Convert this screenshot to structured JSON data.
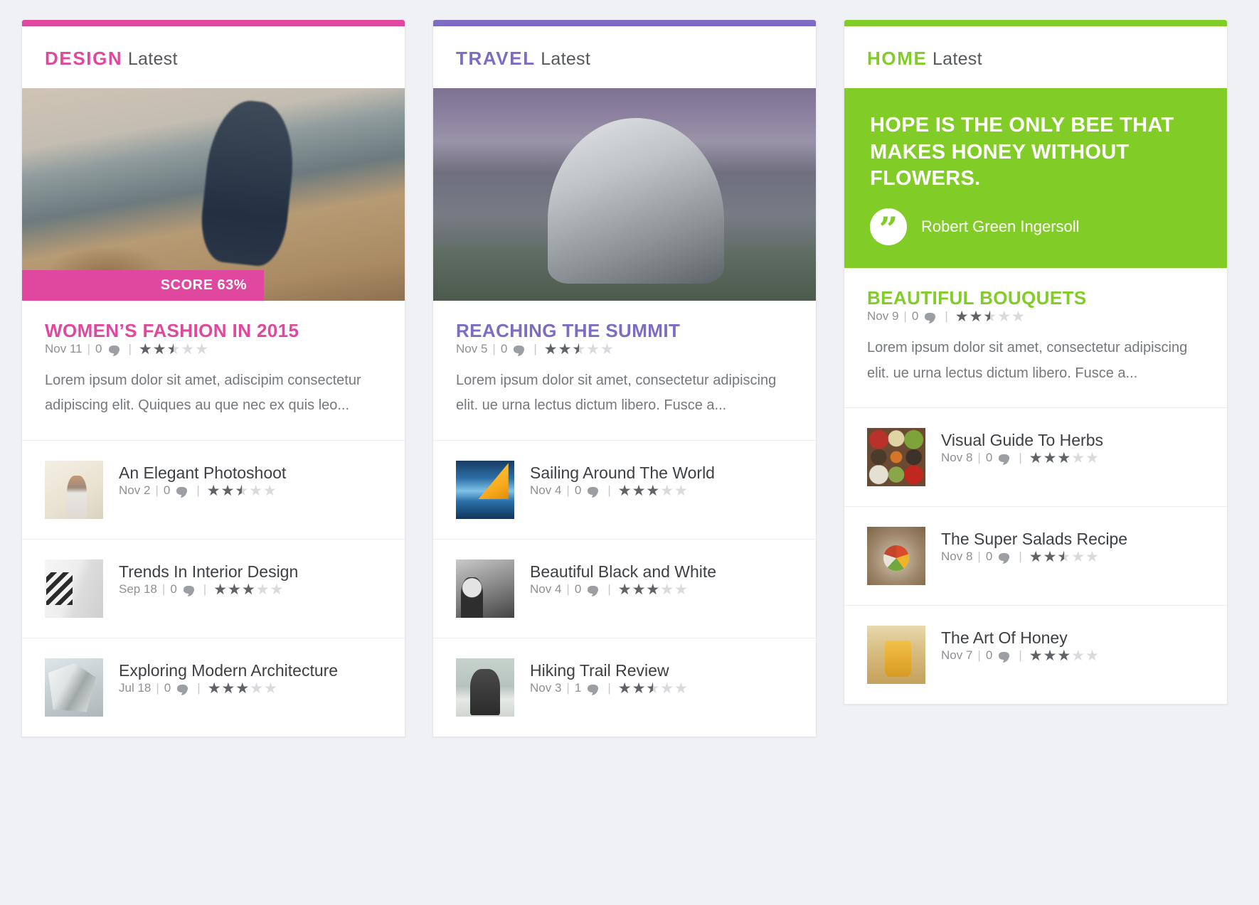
{
  "page": {
    "background": "#eff1f4"
  },
  "columns": [
    {
      "id": "design",
      "accent": "#e0479e",
      "header": {
        "category": "DESIGN",
        "subtitle": "Latest"
      },
      "hero": {
        "image_name": "woman-on-dock-photo",
        "badge": {
          "label": "SCORE 63%",
          "value": 63
        }
      },
      "featured": {
        "title": "WOMEN’S FASHION IN 2015",
        "date": "Nov 11",
        "comments": "0",
        "rating": 2.5,
        "excerpt": "Lorem ipsum dolor sit amet, adiscipim consectetur adipiscing elit. Quiques au que nec ex quis leo..."
      },
      "items": [
        {
          "title": "An Elegant Photoshoot",
          "date": "Nov 2",
          "comments": "0",
          "rating": 2.5,
          "image_name": "elegant-photoshoot-thumb"
        },
        {
          "title": "Trends In Interior Design",
          "date": "Sep 18",
          "comments": "0",
          "rating": 3,
          "image_name": "interior-design-thumb"
        },
        {
          "title": "Exploring Modern Architecture",
          "date": "Jul 18",
          "comments": "0",
          "rating": 3,
          "image_name": "modern-architecture-thumb"
        }
      ]
    },
    {
      "id": "travel",
      "accent": "#7d6bc4",
      "header": {
        "category": "TRAVEL",
        "subtitle": "Latest"
      },
      "hero": {
        "image_name": "half-dome-mountain-photo"
      },
      "featured": {
        "title": "REACHING THE SUMMIT",
        "date": "Nov 5",
        "comments": "0",
        "rating": 2.5,
        "excerpt": "Lorem ipsum dolor sit amet, consectetur adipiscing elit. ue urna lectus dictum libero. Fusce a..."
      },
      "items": [
        {
          "title": "Sailing Around The World",
          "date": "Nov 4",
          "comments": "0",
          "rating": 3,
          "image_name": "sailboat-thumb"
        },
        {
          "title": "Beautiful Black and White",
          "date": "Nov 4",
          "comments": "0",
          "rating": 3,
          "image_name": "black-and-white-portrait-thumb"
        },
        {
          "title": "Hiking Trail Review",
          "date": "Nov 3",
          "comments": "1",
          "rating": 2.5,
          "image_name": "hikers-thumb"
        }
      ]
    },
    {
      "id": "home",
      "accent": "#82cc28",
      "header": {
        "category": "HOME",
        "subtitle": "Latest"
      },
      "quote": {
        "text": "HOPE IS THE ONLY BEE THAT MAKES HONEY WITHOUT FLOWERS.",
        "author": "Robert Green Ingersoll",
        "mark_icon": "quote-icon"
      },
      "featured": {
        "title": "BEAUTIFUL BOUQUETS",
        "date": "Nov 9",
        "comments": "0",
        "rating": 2.5,
        "excerpt": "Lorem ipsum dolor sit amet, consectetur adipiscing elit. ue urna lectus dictum libero. Fusce a..."
      },
      "items": [
        {
          "title": "Visual Guide To Herbs",
          "date": "Nov 8",
          "comments": "0",
          "rating": 3,
          "image_name": "herbs-thumb"
        },
        {
          "title": "The Super Salads Recipe",
          "date": "Nov 8",
          "comments": "0",
          "rating": 2.5,
          "image_name": "salad-thumb"
        },
        {
          "title": "The Art Of Honey",
          "date": "Nov 7",
          "comments": "0",
          "rating": 3,
          "image_name": "honey-jar-thumb"
        }
      ]
    }
  ]
}
